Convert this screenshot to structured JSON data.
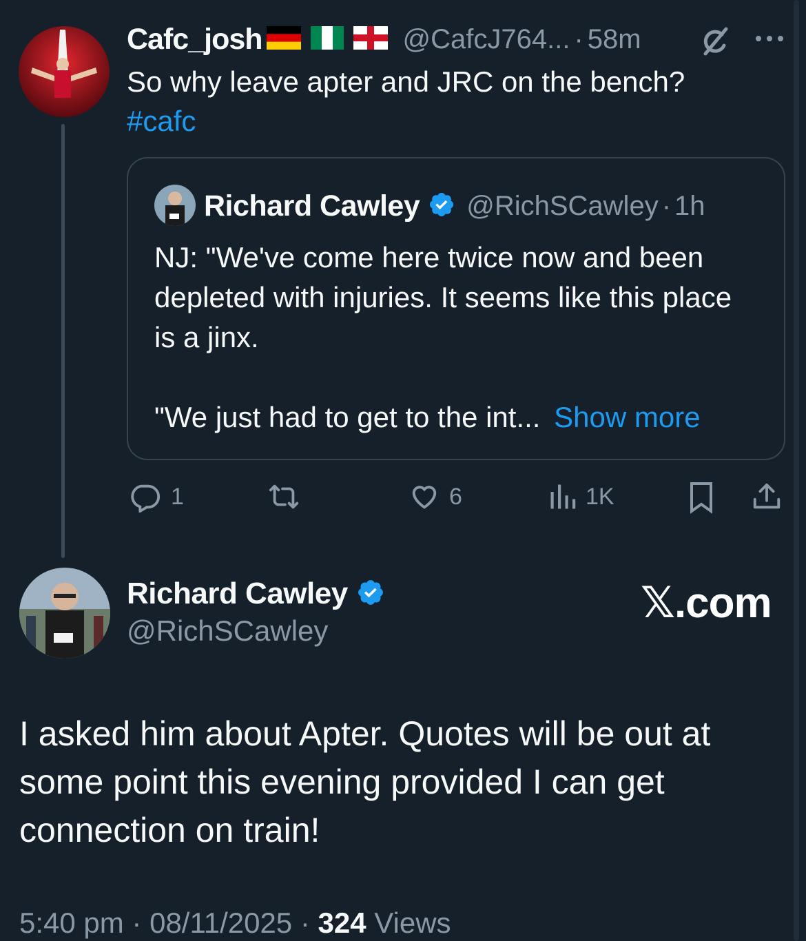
{
  "reply": {
    "display_name": "Cafc_josh",
    "handle": "@CafcJ764...",
    "time": "58m",
    "text_line": "So why leave apter and JRC on the bench?",
    "hashtag": "#cafc",
    "flags": [
      "germany-flag",
      "nigeria-flag",
      "england-flag"
    ]
  },
  "quoted": {
    "display_name": "Richard Cawley",
    "handle": "@RichSCawley",
    "time": "1h",
    "text_p1": "NJ: \"We've come here twice now and been depleted with injuries. It seems like this place is a jinx.",
    "text_p2": "\"We just had to get to the int...",
    "show_more": "Show more"
  },
  "actions": {
    "replies": "1",
    "likes": "6",
    "views": "1K"
  },
  "main": {
    "display_name": "Richard Cawley",
    "handle": "@RichSCawley",
    "watermark": "𝕏.com",
    "text": "I asked him about Apter. Quotes will be out at some point this evening provided I can get connection on train!",
    "timestamp": "5:40 pm · 08/11/2025 · ",
    "view_count": "324",
    "views_label": "Views"
  },
  "colors": {
    "background": "#15202b",
    "text": "#f7f9f9",
    "muted": "#8b98a5",
    "accent": "#1d9bf0"
  }
}
